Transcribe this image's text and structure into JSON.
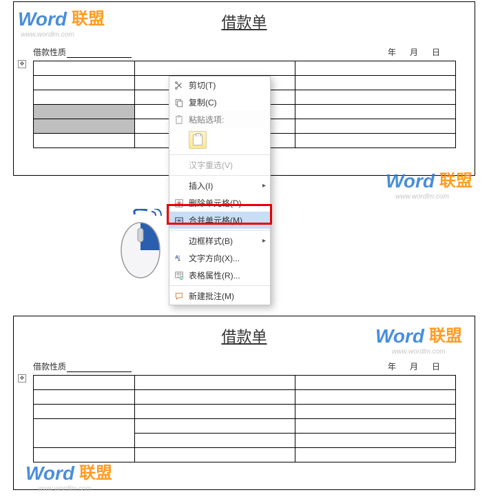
{
  "doc": {
    "title": "借款单",
    "loan_type_label": "借款性质",
    "date": {
      "year": "年",
      "month": "月",
      "day": "日"
    }
  },
  "menu": {
    "cut": "剪切(T)",
    "copy": "复制(C)",
    "paste_header": "粘贴选项:",
    "ime": "汉字重选(V)",
    "insert": "插入(I)",
    "delcell": "删除单元格(D)...",
    "merge": "合并单元格(M)",
    "border": "边框样式(B)",
    "textdir": "文字方向(X)...",
    "tableprops": "表格属性(R)...",
    "newcomment": "新建批注(M)"
  },
  "watermark": {
    "brand1": "Word",
    "brand2": "联盟",
    "url": "www.wordlm.com"
  }
}
